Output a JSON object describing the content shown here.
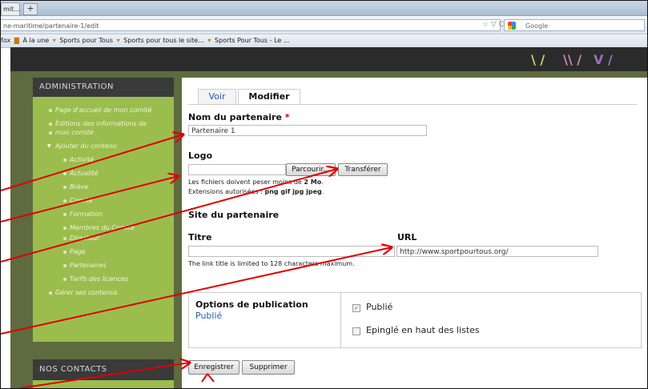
{
  "browser": {
    "tab_title": "mit...",
    "new_tab": "+",
    "url": "ne-maritime/partenaire-1/edit",
    "url_controls": "☆ ▽ C",
    "search_placeholder": "Google",
    "bookmarks": [
      "fox",
      "À la une",
      "Sports pour Tous",
      "Sports pour tous le site...",
      "Sports Pour Tous - Le ..."
    ]
  },
  "sidebar": {
    "admin_title": "ADMINISTRATION",
    "items": [
      "Page d'accueil de mon comité",
      "Editions des informations de",
      "mon comité",
      "Ajouter du contenu",
      "Activité",
      "Actualité",
      "Brève",
      "Comité",
      "Formation",
      "Membres du Comité",
      "Directeur",
      "Page",
      "Partenaires",
      "Tarifs des licences",
      "Gérer ses contenus"
    ],
    "contacts_title": "NOS CONTACTS"
  },
  "tabs": {
    "view": "Voir",
    "edit": "Modifier"
  },
  "form": {
    "name_label": "Nom du partenaire",
    "required_mark": "*",
    "name_value": "Partenaire 1",
    "logo_label": "Logo",
    "browse_button": "Parcourir...",
    "upload_button": "Transférer",
    "help_size": "Les fichiers doivent peser moins de",
    "help_size_value": "2 Mo",
    "help_ext": "Extensions autorisées :",
    "help_ext_value": "png gif jpg jpeg",
    "site_label": "Site du partenaire",
    "title_label": "Titre",
    "title_value": "",
    "url_label": "URL",
    "url_value": "http://www.sportpourtous.org/",
    "title_help": "The link title is limited to 128 characters maximum.",
    "pub_options_label": "Options de publication",
    "pub_status": "Publié",
    "published_label": "Publié",
    "published_checked": true,
    "sticky_label": "Epinglé en haut des listes",
    "sticky_checked": false,
    "save_button": "Enregistrer",
    "delete_button": "Supprimer"
  },
  "colors": {
    "sidebar_green": "#9bbd4e",
    "dark_header": "#2b2b2b",
    "link_blue": "#2a59b7",
    "arrow_red": "#e00000"
  }
}
